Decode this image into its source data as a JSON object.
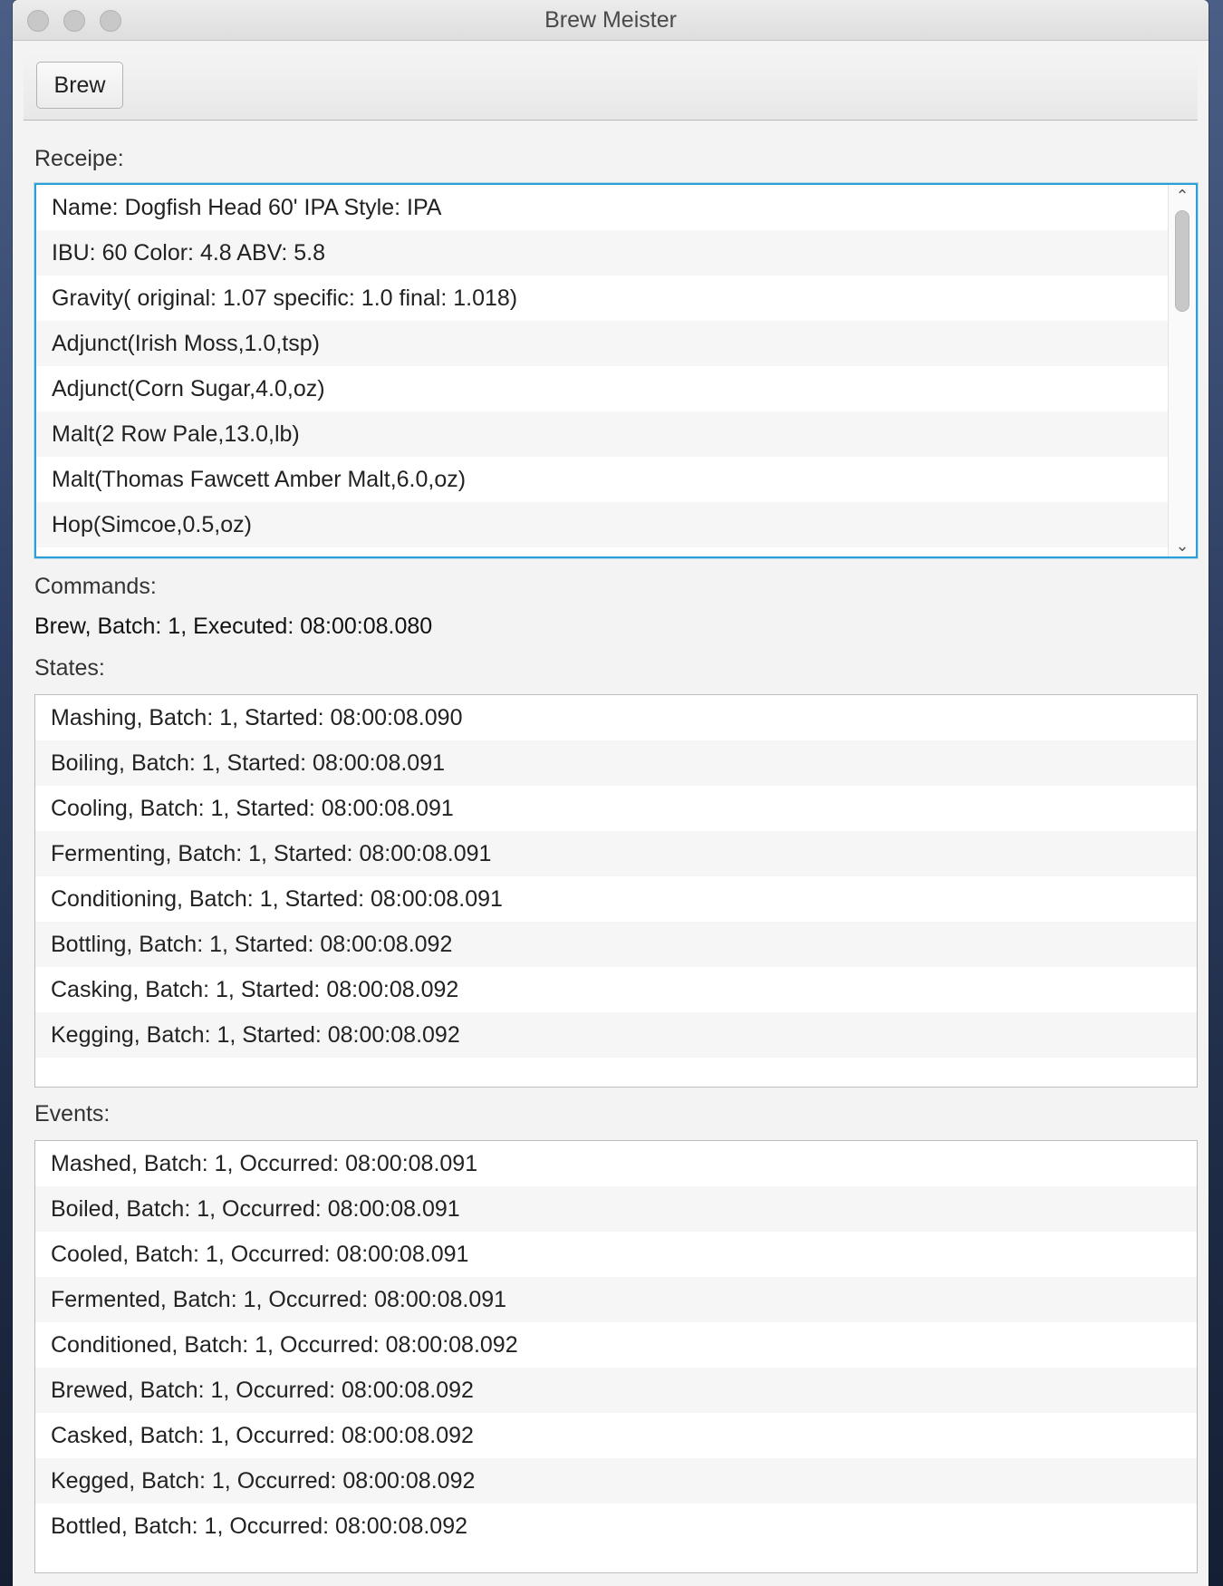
{
  "window": {
    "title": "Brew Meister"
  },
  "toolbar": {
    "brew_label": "Brew"
  },
  "recipe": {
    "label": "Receipe:",
    "items": [
      "Name: Dogfish Head 60' IPA Style: IPA",
      "IBU: 60 Color: 4.8 ABV: 5.8",
      "Gravity( original: 1.07 specific: 1.0 final: 1.018)",
      "Adjunct(Irish Moss,1.0,tsp)",
      "Adjunct(Corn Sugar,4.0,oz)",
      "Malt(2 Row Pale,13.0,lb)",
      "Malt(Thomas Fawcett Amber Malt,6.0,oz)",
      "Hop(Simcoe,0.5,oz)"
    ],
    "scroll_up_glyph": "⌃",
    "scroll_down_glyph": "⌄"
  },
  "commands": {
    "label": "Commands:",
    "text": "Brew, Batch: 1, Executed: 08:00:08.080"
  },
  "states": {
    "label": "States:",
    "items": [
      "Mashing, Batch: 1, Started: 08:00:08.090",
      "Boiling, Batch: 1, Started: 08:00:08.091",
      "Cooling, Batch: 1, Started: 08:00:08.091",
      "Fermenting, Batch: 1, Started: 08:00:08.091",
      "Conditioning, Batch: 1, Started: 08:00:08.091",
      "Bottling, Batch: 1, Started: 08:00:08.092",
      "Casking, Batch: 1, Started: 08:00:08.092",
      "Kegging, Batch: 1, Started: 08:00:08.092"
    ]
  },
  "events": {
    "label": "Events:",
    "items": [
      "Mashed, Batch: 1, Occurred: 08:00:08.091",
      "Boiled, Batch: 1, Occurred: 08:00:08.091",
      "Cooled, Batch: 1, Occurred: 08:00:08.091",
      "Fermented, Batch: 1, Occurred: 08:00:08.091",
      "Conditioned, Batch: 1, Occurred: 08:00:08.092",
      "Brewed, Batch: 1, Occurred: 08:00:08.092",
      "Casked, Batch: 1, Occurred: 08:00:08.092",
      "Kegged, Batch: 1, Occurred: 08:00:08.092",
      "Bottled, Batch: 1, Occurred: 08:00:08.092"
    ]
  },
  "colors": {
    "focus_ring": "#2c9fd8",
    "window_bg": "#f3f3f3",
    "list_alt_row": "#f6f6f6"
  }
}
